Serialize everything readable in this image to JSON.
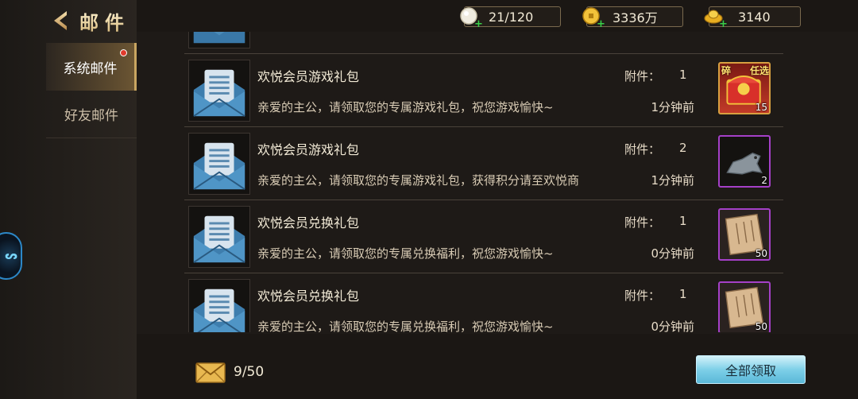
{
  "header": {
    "title": "邮件",
    "back_icon": "chevron-left-icon"
  },
  "sidebar": {
    "items": [
      {
        "label": "系统邮件",
        "active": true,
        "has_notification": true
      },
      {
        "label": "好友邮件",
        "active": false,
        "has_notification": false
      }
    ]
  },
  "floating_ball": {
    "text": "ᔕ"
  },
  "resources": [
    {
      "icon": "pearl-icon",
      "value": "21/120"
    },
    {
      "icon": "gold-coins-icon",
      "value": "3336万"
    },
    {
      "icon": "gold-ingot-icon",
      "value": "3140"
    }
  ],
  "mails": [
    {
      "title": "欢悦会员游戏礼包",
      "desc": "亲爱的主公，请领取您的专属游戏礼包，祝您游戏愉快~",
      "attachment_label": "附件：",
      "attachment_count": "1",
      "time": "1分钟前",
      "item": {
        "icon": "red-treasure-chest-icon",
        "badge_left": "碎",
        "badge_right": "任选",
        "qty": "15"
      }
    },
    {
      "title": "欢悦会员游戏礼包",
      "desc": "亲爱的主公，请领取您的专属游戏礼包，获得积分请至欢悦商",
      "attachment_label": "附件：",
      "attachment_count": "2",
      "time": "1分钟前",
      "item": {
        "icon": "stone-beast-icon",
        "badge_left": "",
        "badge_right": "",
        "qty": "2"
      }
    },
    {
      "title": "欢悦会员兑换礼包",
      "desc": "亲爱的主公，请领取您的专属兑换福利，祝您游戏愉快~",
      "attachment_label": "附件：",
      "attachment_count": "1",
      "time": "0分钟前",
      "item": {
        "icon": "scroll-parchment-icon",
        "badge_left": "",
        "badge_right": "",
        "qty": "50"
      }
    },
    {
      "title": "欢悦会员兑换礼包",
      "desc": "亲爱的主公，请领取您的专属兑换福利，祝您游戏愉快~",
      "attachment_label": "附件：",
      "attachment_count": "1",
      "time": "0分钟前",
      "item": {
        "icon": "scroll-parchment-icon",
        "badge_left": "",
        "badge_right": "",
        "qty": "50"
      }
    }
  ],
  "footer": {
    "mail_icon": "envelope-icon",
    "mail_count": "9/50",
    "claim_all_label": "全部领取"
  },
  "colors": {
    "accent_gold": "#c9a561",
    "item_border_purple": "#a540c8",
    "button_cyan": "#7ed0e8"
  }
}
